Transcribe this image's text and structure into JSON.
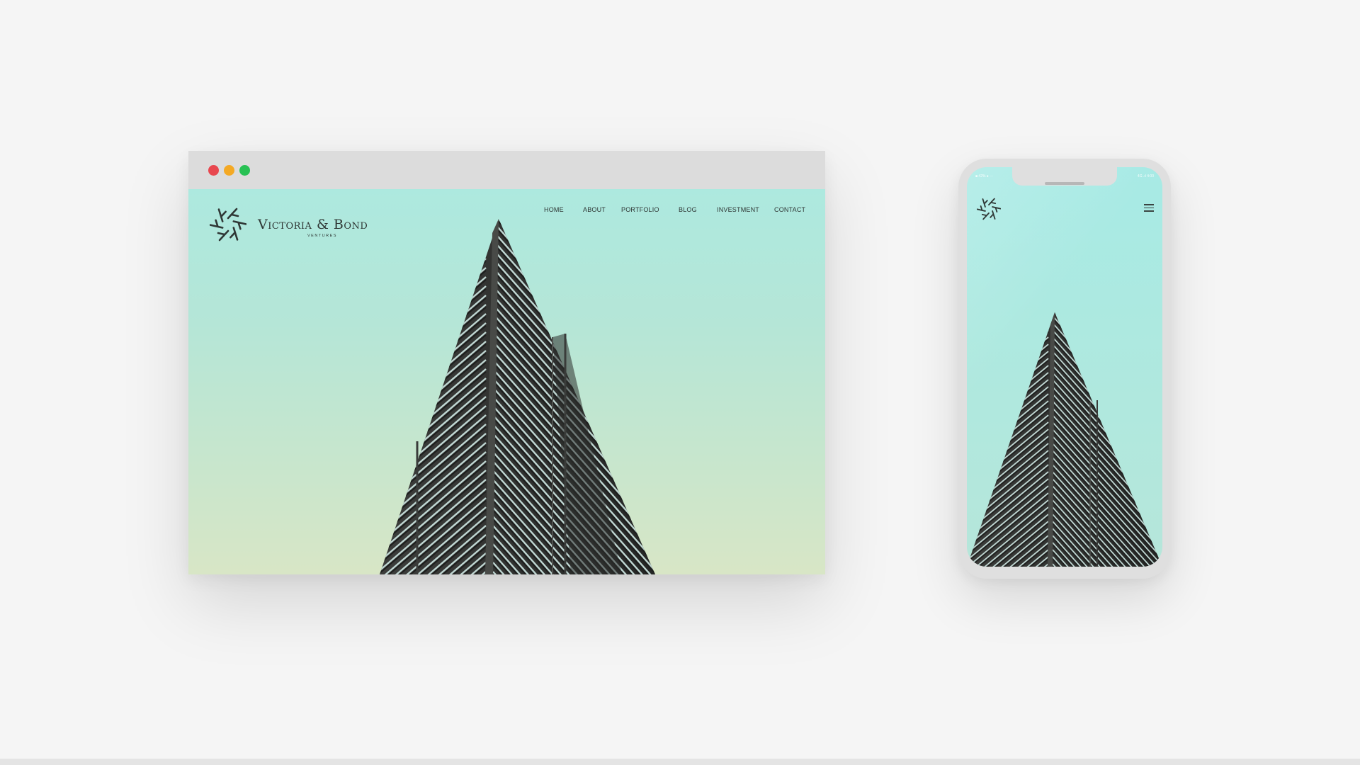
{
  "browser": {
    "window_controls": [
      "close",
      "minimize",
      "maximize"
    ],
    "colors": {
      "close": "#e8474f",
      "minimize": "#f4a924",
      "maximize": "#28c154"
    }
  },
  "site": {
    "logo": {
      "name": "Victoria & Bond",
      "tagline": "VENTURES",
      "icon": "pinwheel-logo-icon"
    },
    "nav": [
      "HOME",
      "ABOUT",
      "PORTFOLIO",
      "BLOG",
      "INVESTMENT",
      "CONTACT"
    ],
    "hero_image": "triangular-skyscraper-photo",
    "colors": {
      "sky_top": "#ade9df",
      "sky_bottom": "#d8e6c6",
      "ink": "#2f3735"
    }
  },
  "phone": {
    "status_left": "■ 42%  ●  ···",
    "status_right": "4G  .ıl  4:00",
    "menu_icon": "hamburger-menu-icon",
    "logo_icon": "pinwheel-logo-icon"
  }
}
